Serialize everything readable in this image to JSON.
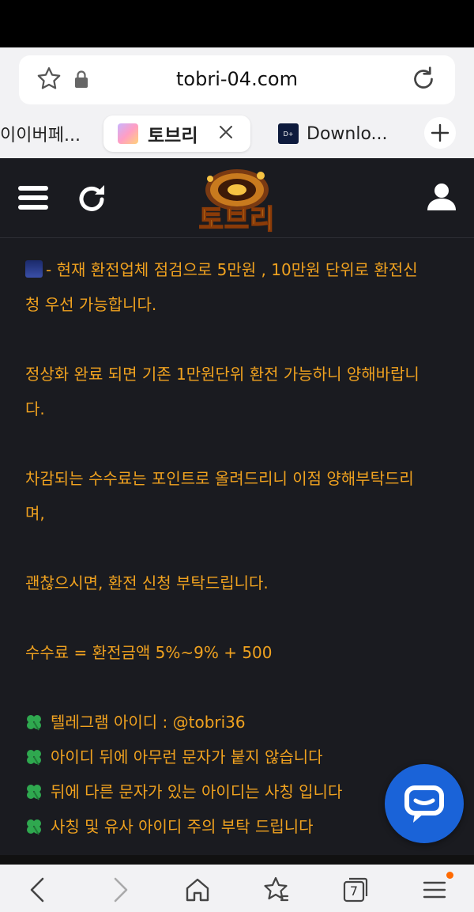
{
  "browser": {
    "url": "tobri-04.com",
    "tabs": [
      {
        "label": "이이버페..."
      },
      {
        "label": "토브리"
      },
      {
        "label": "Downlo..."
      }
    ],
    "tab_count": "7"
  },
  "site": {
    "logo_text": "토브리"
  },
  "notice": {
    "line1": "- 현재 환전업체 점검으로 5만원 , 10만원 단위로 환전신",
    "line2": "청 우선 가능합니다.",
    "line3": "정상화 완료 되면 기존 1만원단위 환전 가능하니 양해바랍니",
    "line4": "다.",
    "line5": "차감되는 수수료는 포인트로 올려드리니 이점 양해부탁드리",
    "line6": "며,",
    "line7": "괜찮으시면, 환전 신청 부탁드립니다.",
    "line8": "수수료 = 환전금액 5%~9% + 500",
    "items": [
      "텔레그램 아이디 : @tobri36",
      "아이디 뒤에 아무런 문자가 붙지 않습니다",
      "뒤에 다른 문자가 있는 아이디는 사칭 입니다",
      "사칭 및 유사 아이디 주의 부탁 드립니다"
    ]
  },
  "colors": {
    "text": "#f0a21f",
    "background": "#1a1b20",
    "fab": "#1a63d8"
  }
}
